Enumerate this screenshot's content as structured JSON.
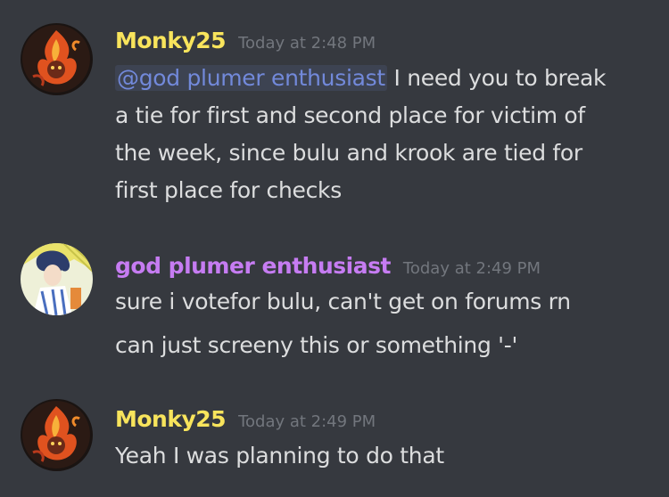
{
  "colors": {
    "background": "#36393f",
    "text": "#dcddde",
    "timestamp": "#72767d",
    "mention": "#7289da"
  },
  "messages": [
    {
      "author": "Monky25",
      "author_color": "#f8e45c",
      "avatar_icon": "fire-monkey-avatar-icon",
      "timestamp": "Today at 2:48 PM",
      "mention": "@god plumer enthusiast",
      "lines": [
        " I need you to break",
        "a tie for first and second place for victim of",
        "the week, since bulu and krook are tied for",
        "first place for checks"
      ]
    },
    {
      "author": "god plumer enthusiast",
      "author_color": "#c67cf2",
      "avatar_icon": "anime-character-avatar-icon",
      "timestamp": "Today at 2:49 PM",
      "lines": [
        "sure i votefor bulu, can't get on forums rn",
        "can just screeny this or something '-'"
      ]
    },
    {
      "author": "Monky25",
      "author_color": "#f8e45c",
      "avatar_icon": "fire-monkey-avatar-icon",
      "timestamp": "Today at 2:49 PM",
      "lines": [
        "Yeah I was planning to do that"
      ]
    }
  ]
}
